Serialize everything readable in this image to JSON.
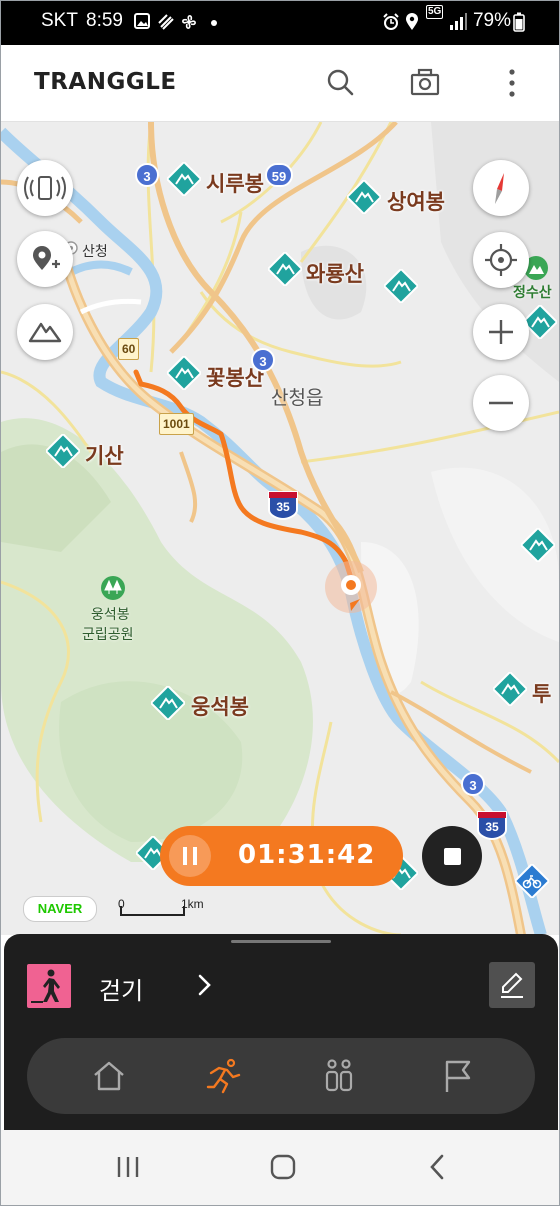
{
  "status_bar": {
    "carrier": "SKT",
    "time": "8:59",
    "network": "5G",
    "battery": "79%"
  },
  "app_bar": {
    "logo_text": "TRANGGLE",
    "icons": [
      "search-icon",
      "camera-icon",
      "more-vertical-icon"
    ]
  },
  "map": {
    "peaks": [
      {
        "name": "시루봉"
      },
      {
        "name": "상여봉"
      },
      {
        "name": "와룡산"
      },
      {
        "name": "꽃봉산"
      },
      {
        "name": "기산"
      },
      {
        "name": "웅석봉"
      },
      {
        "name": "투"
      }
    ],
    "place_labels": {
      "town": "산청읍",
      "sancheong": "산청",
      "jeongsusan": "정수산",
      "park_line1": "웅석봉",
      "park_line2": "군립공원"
    },
    "route_badges": {
      "r3a": "3",
      "r59": "59",
      "r3b": "3",
      "r60": "60",
      "r1001": "1001",
      "r35a": "35",
      "r3c": "3",
      "r35b": "35"
    },
    "provider": "NAVER",
    "scale": {
      "start": "0",
      "end": "1km"
    },
    "colors": {
      "track": "#f47920",
      "river": "#9fc8ea",
      "highway": "#f3c98b",
      "green": "#dbe9d0"
    }
  },
  "recording": {
    "elapsed": "01:31:42",
    "state": "recording"
  },
  "bottom_sheet": {
    "activity_label": "걷기",
    "activity_color": "#f06292",
    "tabs": [
      {
        "name": "home",
        "active": false
      },
      {
        "name": "activity",
        "active": true
      },
      {
        "name": "people",
        "active": false
      },
      {
        "name": "flag",
        "active": false
      }
    ]
  }
}
